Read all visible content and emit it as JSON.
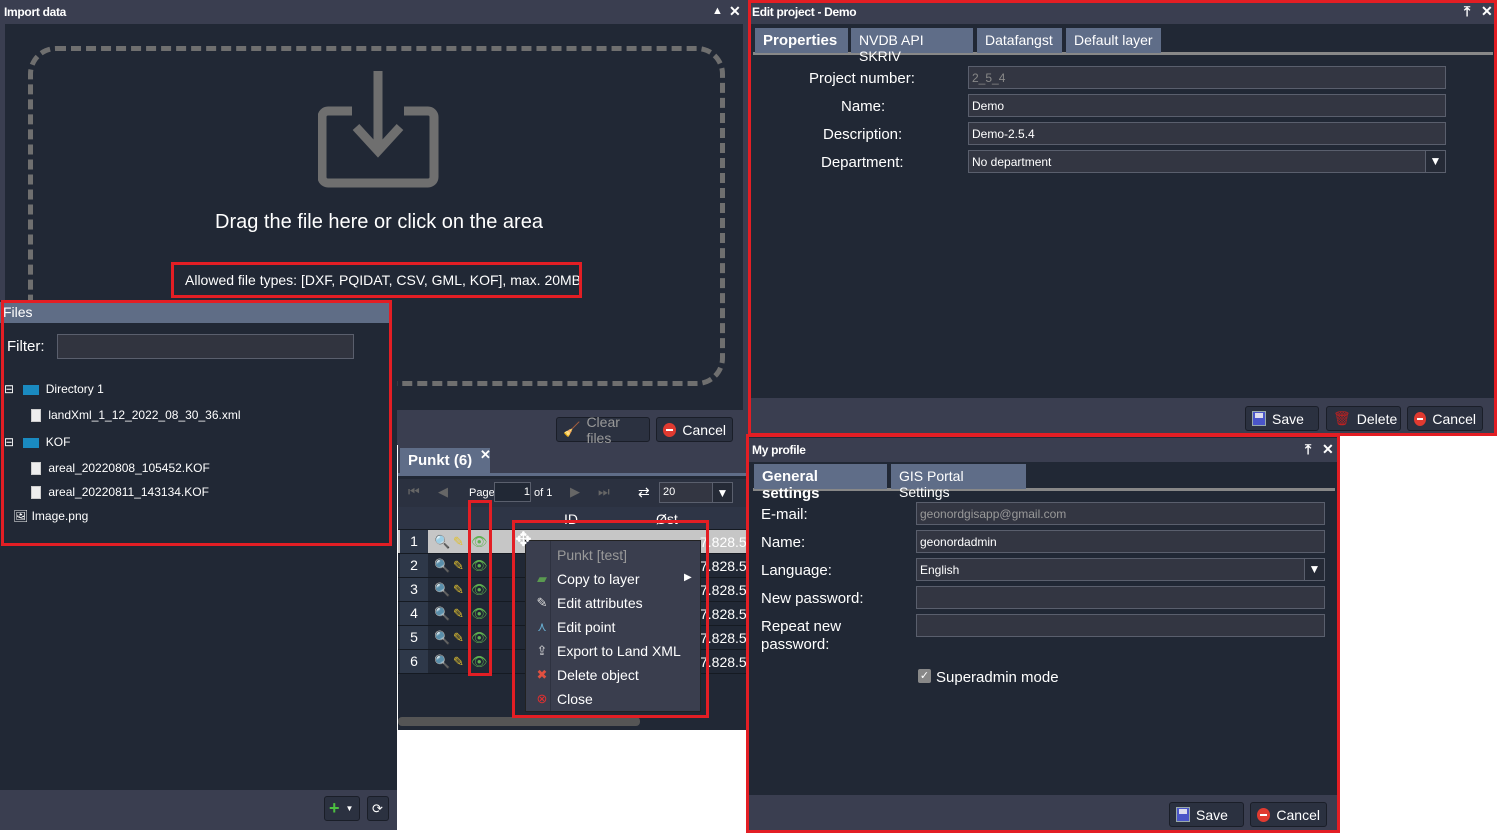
{
  "import_window": {
    "title": "Import data",
    "drop_text": "Drag the file here or click on the area",
    "allowed_types": "Allowed file types: [DXF, PQIDAT, CSV, GML, KOF], max. 20MB",
    "clear_files_label": "Clear files",
    "cancel_label": "Cancel"
  },
  "files_panel": {
    "title": "Files",
    "filter_label": "Filter:",
    "filter_value": "",
    "tree": [
      {
        "label": "Directory 1",
        "type": "folder",
        "children": [
          {
            "label": "landXml_1_12_2022_08_30_36.xml",
            "type": "file"
          }
        ]
      },
      {
        "label": "KOF",
        "type": "folder",
        "children": [
          {
            "label": "areal_20220808_105452.KOF",
            "type": "file"
          },
          {
            "label": "areal_20220811_143134.KOF",
            "type": "file"
          }
        ]
      },
      {
        "label": "Image.png",
        "type": "image"
      }
    ]
  },
  "punkt_panel": {
    "tab_label": "Punkt (6)",
    "pager": {
      "page_label": "Page",
      "page_value": "1",
      "of_label": "of 1",
      "page_size": "20"
    },
    "columns": [
      "ID",
      "Øst"
    ],
    "rows": [
      {
        "num": "1",
        "ost": "7.828.5",
        "selected": true
      },
      {
        "num": "2",
        "ost": "7.828.5"
      },
      {
        "num": "3",
        "ost": "7.828.5"
      },
      {
        "num": "4",
        "ost": "7.828.5"
      },
      {
        "num": "5",
        "ost": "7.828.5"
      },
      {
        "num": "6",
        "ost": "7.828.5"
      }
    ]
  },
  "context_menu": {
    "header": "Punkt [test]",
    "items": [
      {
        "label": "Copy to layer",
        "icon": "copy-layer-icon",
        "submenu": true
      },
      {
        "label": "Edit attributes",
        "icon": "pencil-icon"
      },
      {
        "label": "Edit point",
        "icon": "edit-point-icon"
      },
      {
        "label": "Export to Land XML",
        "icon": "export-icon"
      },
      {
        "label": "Delete object",
        "icon": "delete-icon"
      },
      {
        "label": "Close",
        "icon": "close-icon"
      }
    ]
  },
  "edit_project": {
    "title": "Edit project - Demo",
    "tabs": [
      "Properties",
      "NVDB API SKRIV",
      "Datafangst",
      "Default layer"
    ],
    "fields": {
      "project_number_label": "Project number:",
      "project_number": "2_5_4",
      "name_label": "Name:",
      "name": "Demo",
      "description_label": "Description:",
      "description": "Demo-2.5.4",
      "department_label": "Department:",
      "department": "No department"
    },
    "save_label": "Save",
    "delete_label": "Delete",
    "cancel_label": "Cancel"
  },
  "my_profile": {
    "title": "My profile",
    "tabs": [
      "General settings",
      "GIS Portal Settings"
    ],
    "fields": {
      "email_label": "E-mail:",
      "email": "geonordgisapp@gmail.com",
      "name_label": "Name:",
      "name": "geonordadmin",
      "language_label": "Language:",
      "language": "English",
      "new_password_label": "New password:",
      "new_password": "",
      "repeat_password_label": "Repeat new password:",
      "repeat_password": "",
      "superadmin_label": "Superadmin mode",
      "superadmin_checked": true
    },
    "save_label": "Save",
    "cancel_label": "Cancel"
  },
  "colors": {
    "highlight": "#e31e24",
    "panel_bg": "#212835",
    "titlebar": "#3a3e50",
    "tab": "#5f6d88"
  }
}
